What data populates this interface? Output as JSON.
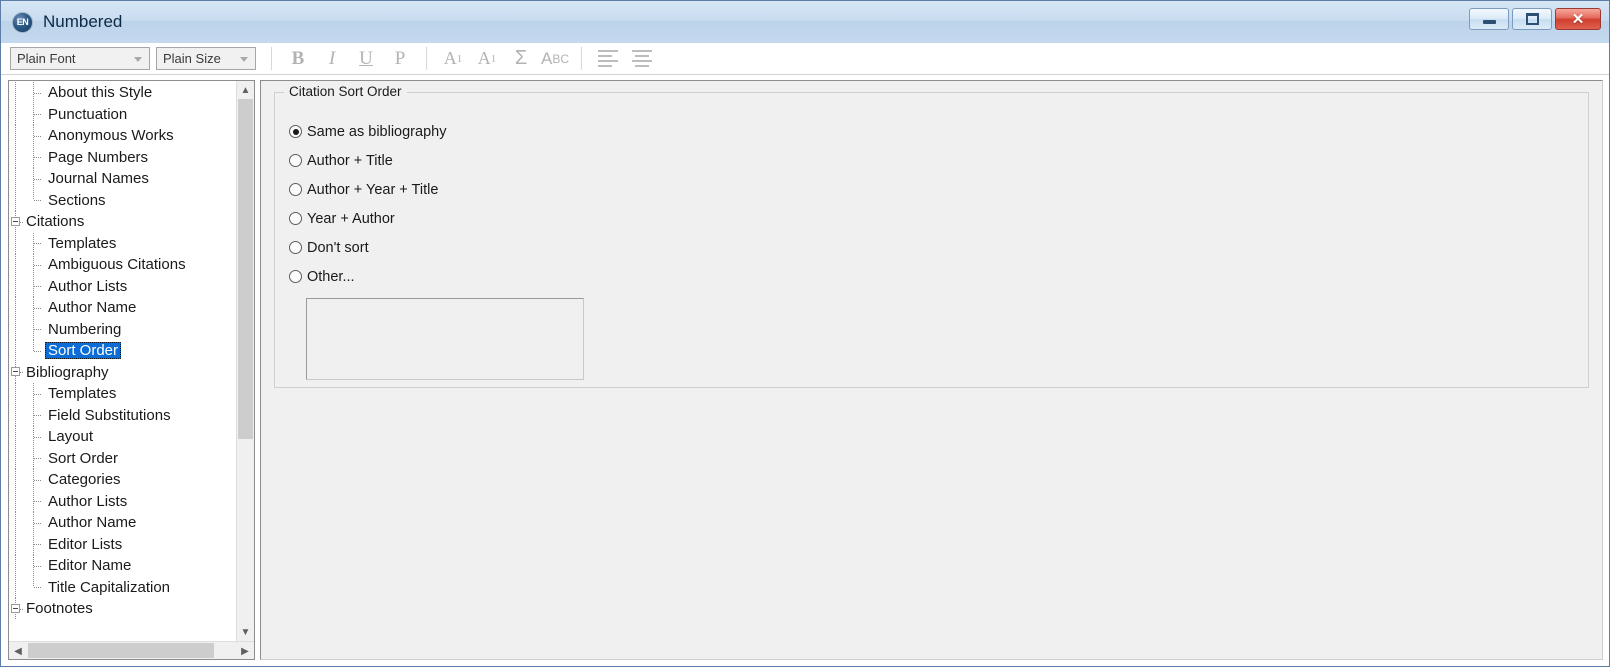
{
  "window": {
    "title": "Numbered",
    "app_icon": "endnote-en-icon",
    "controls": {
      "minimize": "minimize-icon",
      "restore": "restore-icon",
      "close": "close-icon",
      "close_glyph": "✕"
    }
  },
  "toolbar": {
    "font_combo": {
      "value": "Plain Font",
      "placeholder": "Plain Font"
    },
    "size_combo": {
      "value": "Plain Size",
      "placeholder": "Plain Size"
    },
    "buttons": [
      {
        "name": "bold-button",
        "label": "B"
      },
      {
        "name": "italic-button",
        "label": "I"
      },
      {
        "name": "underline-button",
        "label": "U"
      },
      {
        "name": "plain-button",
        "label": "P"
      },
      {
        "name": "superscript-button",
        "label": "A"
      },
      {
        "name": "subscript-button",
        "label": "A"
      },
      {
        "name": "symbol-button",
        "label": "Σ"
      },
      {
        "name": "smallcaps-button",
        "label": "A"
      },
      {
        "name": "align-left-button",
        "label": ""
      },
      {
        "name": "align-center-button",
        "label": ""
      }
    ],
    "superscript_mark": "1",
    "subscript_mark": "1",
    "smallcaps_mark": "BC"
  },
  "tree": {
    "items": [
      {
        "label": "About this Style",
        "level": 1,
        "expander": false,
        "selected": false
      },
      {
        "label": "Punctuation",
        "level": 1,
        "expander": false,
        "selected": false
      },
      {
        "label": "Anonymous Works",
        "level": 1,
        "expander": false,
        "selected": false
      },
      {
        "label": "Page Numbers",
        "level": 1,
        "expander": false,
        "selected": false
      },
      {
        "label": "Journal Names",
        "level": 1,
        "expander": false,
        "selected": false
      },
      {
        "label": "Sections",
        "level": 1,
        "expander": false,
        "selected": false
      },
      {
        "label": "Citations",
        "level": 0,
        "expander": true,
        "selected": false
      },
      {
        "label": "Templates",
        "level": 1,
        "expander": false,
        "selected": false
      },
      {
        "label": "Ambiguous Citations",
        "level": 1,
        "expander": false,
        "selected": false
      },
      {
        "label": "Author Lists",
        "level": 1,
        "expander": false,
        "selected": false
      },
      {
        "label": "Author Name",
        "level": 1,
        "expander": false,
        "selected": false
      },
      {
        "label": "Numbering",
        "level": 1,
        "expander": false,
        "selected": false
      },
      {
        "label": "Sort Order",
        "level": 1,
        "expander": false,
        "selected": true
      },
      {
        "label": "Bibliography",
        "level": 0,
        "expander": true,
        "selected": false
      },
      {
        "label": "Templates",
        "level": 1,
        "expander": false,
        "selected": false
      },
      {
        "label": "Field Substitutions",
        "level": 1,
        "expander": false,
        "selected": false
      },
      {
        "label": "Layout",
        "level": 1,
        "expander": false,
        "selected": false
      },
      {
        "label": "Sort Order",
        "level": 1,
        "expander": false,
        "selected": false
      },
      {
        "label": "Categories",
        "level": 1,
        "expander": false,
        "selected": false
      },
      {
        "label": "Author Lists",
        "level": 1,
        "expander": false,
        "selected": false
      },
      {
        "label": "Author Name",
        "level": 1,
        "expander": false,
        "selected": false
      },
      {
        "label": "Editor Lists",
        "level": 1,
        "expander": false,
        "selected": false
      },
      {
        "label": "Editor Name",
        "level": 1,
        "expander": false,
        "selected": false
      },
      {
        "label": "Title Capitalization",
        "level": 1,
        "expander": false,
        "selected": false
      },
      {
        "label": "Footnotes",
        "level": 0,
        "expander": true,
        "selected": false
      }
    ],
    "scroll_up_icon": "chevron-up-icon",
    "scroll_down_icon": "chevron-down-icon",
    "scroll_left_icon": "chevron-left-icon",
    "scroll_right_icon": "chevron-right-icon"
  },
  "main": {
    "group_title": "Citation Sort Order",
    "options": [
      {
        "label": "Same as bibliography",
        "checked": true
      },
      {
        "label": "Author + Title",
        "checked": false
      },
      {
        "label": "Author + Year + Title",
        "checked": false
      },
      {
        "label": "Year + Author",
        "checked": false
      },
      {
        "label": "Don't sort",
        "checked": false
      },
      {
        "label": "Other...",
        "checked": false
      }
    ],
    "other_textarea": {
      "value": "",
      "placeholder": ""
    }
  },
  "colors": {
    "selection": "#0a6cd4",
    "titlebar": "#c9dcf0",
    "panel_bg": "#f0f0f0",
    "frame": "#b4cde6",
    "close_button": "#cf3f2e"
  }
}
